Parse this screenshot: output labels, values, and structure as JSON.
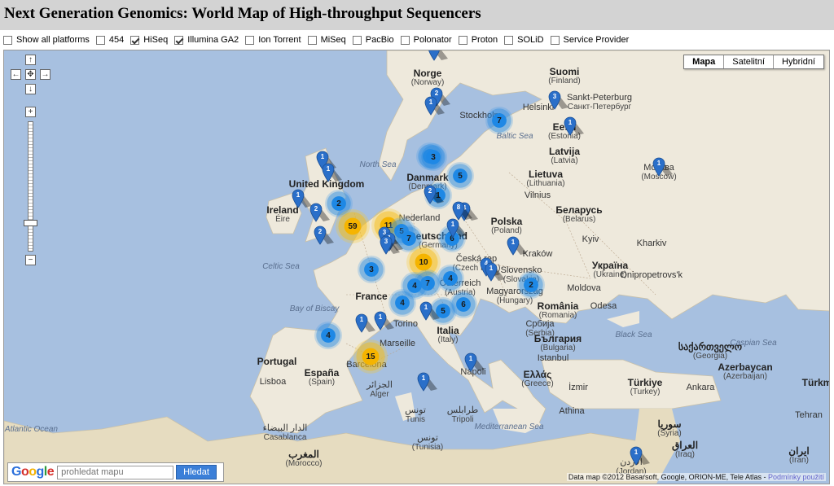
{
  "page_title": "Next Generation Genomics: World Map of High-throughput Sequencers",
  "filters": [
    {
      "label": "Show all platforms",
      "checked": false
    },
    {
      "label": "454",
      "checked": false
    },
    {
      "label": "HiSeq",
      "checked": true
    },
    {
      "label": "Illumina GA2",
      "checked": true
    },
    {
      "label": "Ion Torrent",
      "checked": false
    },
    {
      "label": "MiSeq",
      "checked": false
    },
    {
      "label": "PacBio",
      "checked": false
    },
    {
      "label": "Polonator",
      "checked": false
    },
    {
      "label": "Proton",
      "checked": false
    },
    {
      "label": "SOLiD",
      "checked": false
    },
    {
      "label": "Service Provider",
      "checked": false
    }
  ],
  "map_types": [
    "Mapa",
    "Satelitní",
    "Hybridní"
  ],
  "map_types_selected": "Mapa",
  "navigation": {
    "up": "↑",
    "down": "↓",
    "left": "←",
    "right": "→",
    "center": "✥",
    "zoom_in": "+",
    "zoom_out": "−"
  },
  "search": {
    "logo": "Google",
    "placeholder": "prohledat mapu",
    "button": "Hledat"
  },
  "attribution": {
    "text": "Data map ©2012 Basarsoft, Google, ORION-ME, Tele Atlas",
    "link": "Podmínky použití"
  },
  "colors": {
    "sea": "#a7c0e0",
    "land": "#eee9dc",
    "cluster_small": "#1e88e5",
    "cluster_large": "#f5b400",
    "pin": "#2a6fc9"
  },
  "places": [
    {
      "name": "Norge",
      "sub": "(Norway)",
      "big": true
    },
    {
      "name": "Suomi",
      "sub": "(Finland)",
      "big": true
    },
    {
      "name": "Sankt-Peterburg",
      "sub": "Санкт-Петербург",
      "big": false
    },
    {
      "name": "Helsinki",
      "sub": "",
      "big": false
    },
    {
      "name": "Stockholm",
      "sub": "",
      "big": false
    },
    {
      "name": "Eesti",
      "sub": "(Estonia)",
      "big": true
    },
    {
      "name": "Latvija",
      "sub": "(Latvia)",
      "big": true
    },
    {
      "name": "Lietuva",
      "sub": "(Lithuania)",
      "big": true
    },
    {
      "name": "Москва",
      "sub": "(Moscow)",
      "big": false
    },
    {
      "name": "Baltic Sea",
      "sub": "",
      "sea": true
    },
    {
      "name": "North Sea",
      "sub": "",
      "sea": true
    },
    {
      "name": "Danmark",
      "sub": "(Denmark)",
      "big": true
    },
    {
      "name": "United Kingdom",
      "sub": "",
      "big": true
    },
    {
      "name": "Ireland",
      "sub": "Éire",
      "big": true
    },
    {
      "name": "Vilnius",
      "sub": "",
      "big": false
    },
    {
      "name": "Беларусь",
      "sub": "(Belarus)",
      "big": true
    },
    {
      "name": "Polska",
      "sub": "(Poland)",
      "big": true
    },
    {
      "name": "Nederland",
      "sub": "",
      "big": false
    },
    {
      "name": "Deutschland",
      "sub": "(Germany)",
      "big": true
    },
    {
      "name": "Kyiv",
      "sub": "",
      "big": false
    },
    {
      "name": "Kharkiv",
      "sub": "",
      "big": false
    },
    {
      "name": "Kraków",
      "sub": "",
      "big": false
    },
    {
      "name": "Česká rep",
      "sub": "(Czech Rep.)",
      "big": false
    },
    {
      "name": "Slovensko",
      "sub": "(Slovakia)",
      "big": false
    },
    {
      "name": "Україна",
      "sub": "(Ukraine)",
      "big": true
    },
    {
      "name": "Dnipropetrovs'k",
      "sub": "",
      "big": false
    },
    {
      "name": "Celtic Sea",
      "sub": "",
      "sea": true
    },
    {
      "name": "Österreich",
      "sub": "(Austria)",
      "big": false
    },
    {
      "name": "Magyarország",
      "sub": "(Hungary)",
      "big": false
    },
    {
      "name": "Moldova",
      "sub": "",
      "big": false
    },
    {
      "name": "France",
      "sub": "",
      "big": true
    },
    {
      "name": "Bay of Biscay",
      "sub": "",
      "sea": true
    },
    {
      "name": "România",
      "sub": "(Romania)",
      "big": true
    },
    {
      "name": "Odesa",
      "sub": "",
      "big": false
    },
    {
      "name": "Torino",
      "sub": "",
      "big": false
    },
    {
      "name": "Србија",
      "sub": "(Serbia)",
      "big": false
    },
    {
      "name": "Italia",
      "sub": "(Italy)",
      "big": true
    },
    {
      "name": "България",
      "sub": "(Bulgaria)",
      "big": true
    },
    {
      "name": "Black Sea",
      "sub": "",
      "sea": true
    },
    {
      "name": "Marseille",
      "sub": "",
      "big": false
    },
    {
      "name": "Portugal",
      "sub": "",
      "big": true
    },
    {
      "name": "España",
      "sub": "(Spain)",
      "big": true
    },
    {
      "name": "Barcelona",
      "sub": "",
      "big": false
    },
    {
      "name": "Lisboa",
      "sub": "",
      "big": false
    },
    {
      "name": "Napoli",
      "sub": "",
      "big": false
    },
    {
      "name": "საქართველო",
      "sub": "(Georgia)",
      "big": true
    },
    {
      "name": "Caspian Sea",
      "sub": "",
      "sea": true
    },
    {
      "name": "Azerbaycan",
      "sub": "(Azerbaijan)",
      "big": true
    },
    {
      "name": "Ελλάς",
      "sub": "(Greece)",
      "big": true
    },
    {
      "name": "Türkiye",
      "sub": "(Turkey)",
      "big": true
    },
    {
      "name": "Türkm",
      "sub": "",
      "big": true
    },
    {
      "name": "Ankara",
      "sub": "",
      "big": false
    },
    {
      "name": "Istanbul",
      "sub": "",
      "big": false
    },
    {
      "name": "İzmir",
      "sub": "",
      "big": false
    },
    {
      "name": "Athina",
      "sub": "",
      "big": false
    },
    {
      "name": "الجزائر",
      "sub": "Alger",
      "big": false
    },
    {
      "name": "تونس",
      "sub": "Tunis",
      "big": false
    },
    {
      "name": "الدار البيضاء",
      "sub": "Casablanca",
      "big": false
    },
    {
      "name": "المغرب",
      "sub": "(Morocco)",
      "big": true
    },
    {
      "name": "Mediterranean Sea",
      "sub": "",
      "sea": true
    },
    {
      "name": "North Atlantic Ocean",
      "sub": "",
      "sea": true
    },
    {
      "name": "Tehran",
      "sub": "",
      "big": false
    },
    {
      "name": "العراق",
      "sub": "(Iraq)",
      "big": true
    },
    {
      "name": "ایران",
      "sub": "(Iran)",
      "big": true
    },
    {
      "name": "سوريا",
      "sub": "(Syria)",
      "big": true
    },
    {
      "name": "الأردن",
      "sub": "(Jordan)",
      "big": false
    },
    {
      "name": "تونس",
      "sub": "(Tunisia)",
      "big": false
    },
    {
      "name": "طرابلس",
      "sub": "Tripoli",
      "big": false
    }
  ],
  "clusters": [
    {
      "count": "7",
      "color": "blue"
    },
    {
      "count": "3",
      "color": "blue"
    },
    {
      "count": "3",
      "color": "blue"
    },
    {
      "count": "5",
      "color": "blue"
    },
    {
      "count": "2",
      "color": "blue"
    },
    {
      "count": "1",
      "color": "blue"
    },
    {
      "count": "59",
      "color": "yellow"
    },
    {
      "count": "11",
      "color": "yellow"
    },
    {
      "count": "5",
      "color": "blue"
    },
    {
      "count": "7",
      "color": "blue"
    },
    {
      "count": "6",
      "color": "blue"
    },
    {
      "count": "3",
      "color": "blue"
    },
    {
      "count": "10",
      "color": "yellow"
    },
    {
      "count": "4",
      "color": "blue"
    },
    {
      "count": "7",
      "color": "blue"
    },
    {
      "count": "4",
      "color": "blue"
    },
    {
      "count": "2",
      "color": "blue"
    },
    {
      "count": "4",
      "color": "blue"
    },
    {
      "count": "6",
      "color": "blue"
    },
    {
      "count": "5",
      "color": "blue"
    },
    {
      "count": "4",
      "color": "blue"
    },
    {
      "count": "15",
      "color": "yellow"
    }
  ],
  "pins": [
    "1",
    "2",
    "3",
    "1",
    "1",
    "1",
    "1",
    "2",
    "2",
    "1",
    "1",
    "2",
    "4",
    "8",
    "1",
    "3",
    "1",
    "3",
    "4",
    "1",
    "1",
    "1",
    "1",
    "1",
    "1",
    "1",
    "1"
  ]
}
